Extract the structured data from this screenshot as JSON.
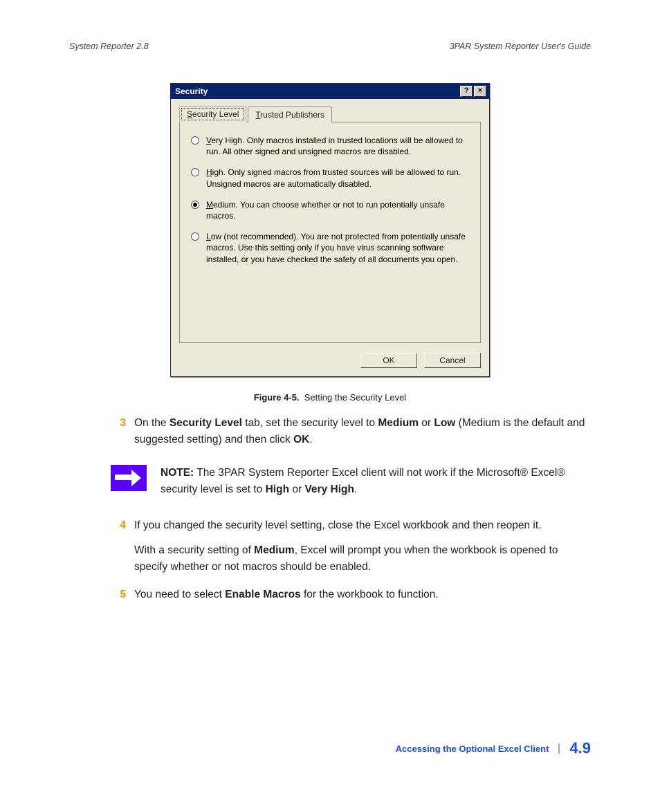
{
  "header": {
    "left": "System Reporter 2.8",
    "right": "3PAR System Reporter User's Guide"
  },
  "dialog": {
    "title": "Security",
    "help_btn": "?",
    "close_btn": "×",
    "tabs": [
      {
        "label_pre": "",
        "label_ul": "S",
        "label_post": "ecurity Level",
        "active": true
      },
      {
        "label_pre": "",
        "label_ul": "T",
        "label_post": "rusted Publishers",
        "active": false
      }
    ],
    "options": [
      {
        "sel": false,
        "ul": "V",
        "pre": "",
        "post": "ery High. Only macros installed in trusted locations will be allowed to run. All other signed and unsigned macros are disabled."
      },
      {
        "sel": false,
        "ul": "H",
        "pre": "",
        "post": "igh. Only signed macros from trusted sources will be allowed to run. Unsigned macros are automatically disabled."
      },
      {
        "sel": true,
        "ul": "M",
        "pre": "",
        "post": "edium. You can choose whether or not to run potentially unsafe macros."
      },
      {
        "sel": false,
        "ul": "L",
        "pre": "",
        "post": "ow (not recommended). You are not protected from potentially unsafe macros. Use this setting only if you have virus scanning software installed, or you have checked the safety of all documents you open."
      }
    ],
    "ok": "OK",
    "cancel": "Cancel"
  },
  "figure": {
    "label": "Figure 4-5.",
    "caption": "Setting the Security Level"
  },
  "step3": {
    "num": "3",
    "t1": "On the ",
    "b1": "Security Level",
    "t2": " tab, set the security level to ",
    "b2": "Medium",
    "t3": " or ",
    "b3": "Low",
    "t4": " (Medium is the default and suggested setting) and then click ",
    "b4": "OK",
    "t5": "."
  },
  "note": {
    "label": "NOTE:",
    "t1": " The 3PAR System Reporter Excel client will not work if the Microsoft® Excel® security level is set to ",
    "b1": "High",
    "t2": " or ",
    "b2": "Very High",
    "t3": "."
  },
  "step4": {
    "num": "4",
    "p1": "If you changed the security level setting, close the Excel workbook and then reopen it.",
    "p2a": "With a security setting of ",
    "p2b": "Medium",
    "p2c": ", Excel will prompt you when the workbook is opened to specify whether or not macros should be enabled."
  },
  "step5": {
    "num": "5",
    "t1": "You need to select ",
    "b1": "Enable Macros",
    "t2": " for the workbook to function."
  },
  "footer": {
    "title": "Accessing the Optional Excel Client",
    "page": "4.9"
  }
}
